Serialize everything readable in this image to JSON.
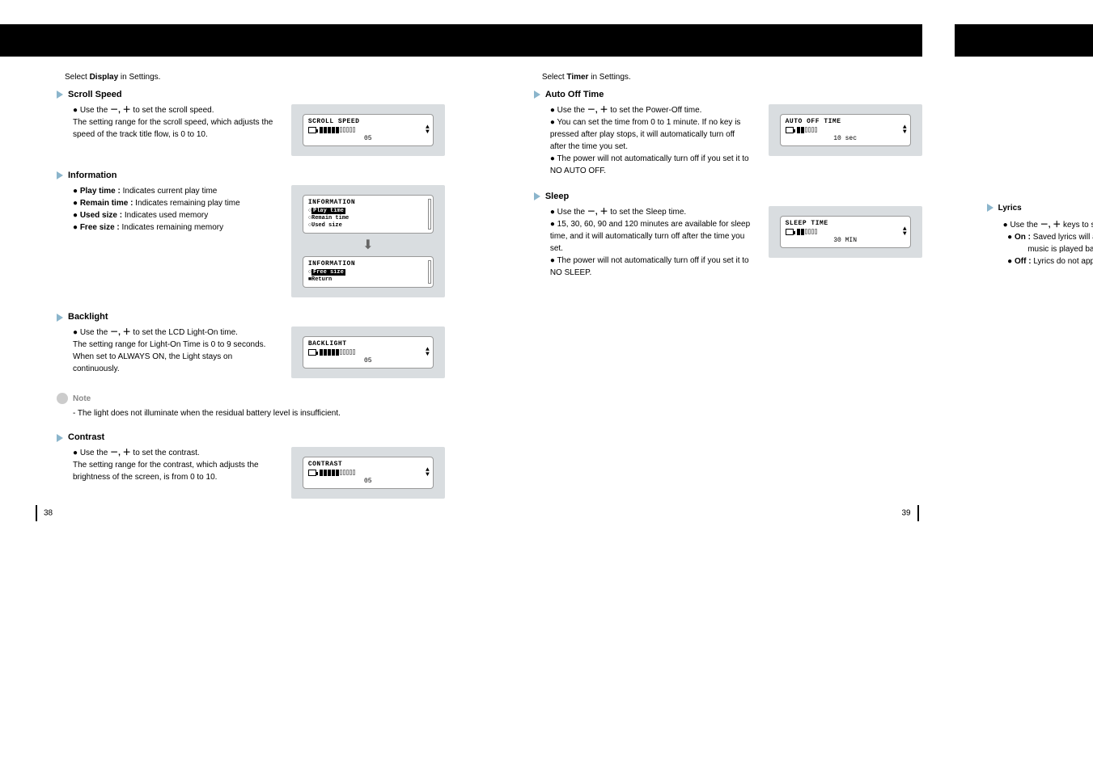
{
  "left_page": {
    "intro_prefix": "Select ",
    "intro_bold": "Display",
    "intro_suffix": " in Settings.",
    "scroll_speed": {
      "heading": "Scroll Speed",
      "line1_prefix": "Use the ",
      "line1_icons": "－, ＋",
      "line1_suffix": " to set the scroll speed.",
      "line2": "The setting range for the scroll speed, which adjusts the speed of the track title flow, is 0 to 10.",
      "lcd_title": "SCROLL SPEED",
      "lcd_value": "05"
    },
    "information": {
      "heading": "Information",
      "b1_label": "Play time :",
      "b1_text": " Indicates current play time",
      "b2_label": "Remain time :",
      "b2_text": " Indicates remaining play time",
      "b3_label": "Used size :",
      "b3_text": " Indicates used memory",
      "b4_label": "Free size :",
      "b4_text": " Indicates remaining memory",
      "lcd_title": "INFORMATION",
      "item1": "Play time",
      "item2": "Remain time",
      "item3": "Used size",
      "item4": "Free size",
      "item5": "Return"
    },
    "backlight": {
      "heading": "Backlight",
      "line1_prefix": "Use the ",
      "line1_icons": "－, ＋",
      "line1_suffix": " to set the LCD Light-On time.",
      "line2": "The setting range for Light-On Time is 0 to 9 seconds.",
      "line3": "When set to ALWAYS ON, the Light stays on continuously.",
      "lcd_title": "BACKLIGHT",
      "lcd_value": "05"
    },
    "note": {
      "label": "Note",
      "text": "- The light does not illuminate when the residual battery level is insufficient."
    },
    "contrast": {
      "heading": "Contrast",
      "line1_prefix": "Use the ",
      "line1_icons": "－, ＋",
      "line1_suffix": " to set the contrast.",
      "line2": "The setting range for the contrast, which adjusts the brightness of the screen, is from 0 to 10.",
      "lcd_title": "CONTRAST",
      "lcd_value": "05"
    },
    "page_num": "38"
  },
  "right_page": {
    "intro_prefix": "Select ",
    "intro_bold": "Timer",
    "intro_suffix": " in Settings.",
    "auto_off": {
      "heading": "Auto Off Time",
      "line1_prefix": "Use the ",
      "line1_icons": "－, ＋",
      "line1_suffix": " to set the Power-Off time.",
      "line2": "You can set the time from 0 to 1 minute. If no key is pressed after play stops, it will automatically turn off after the time you set.",
      "line3": "The power will not automatically turn off if you set it to NO AUTO OFF.",
      "lcd_title": "AUTO OFF TIME",
      "lcd_value": "10 sec"
    },
    "sleep": {
      "heading": "Sleep",
      "line1_prefix": "Use the ",
      "line1_icons": "－, ＋",
      "line1_suffix": " to set the Sleep time.",
      "line2": "15, 30, 60, 90 and 120 minutes are available for sleep time, and it will automatically turn off after the time you set.",
      "line3": "The power will not automatically turn off if you set it to NO SLEEP.",
      "lcd_title": "SLEEP TIME",
      "lcd_value": "30 MIN"
    },
    "page_num": "39"
  },
  "cut_page": {
    "heading": "Lyrics",
    "line1_prefix": "Use the ",
    "line1_icons": "－, ＋",
    "line1_suffix": " keys to select L",
    "b1_label": "On :",
    "b1_text": " Saved lyrics will appear in",
    "b1_text2": "music is played back.",
    "b2_label": "Off :",
    "b2_text": " Lyrics do not appear eve"
  }
}
